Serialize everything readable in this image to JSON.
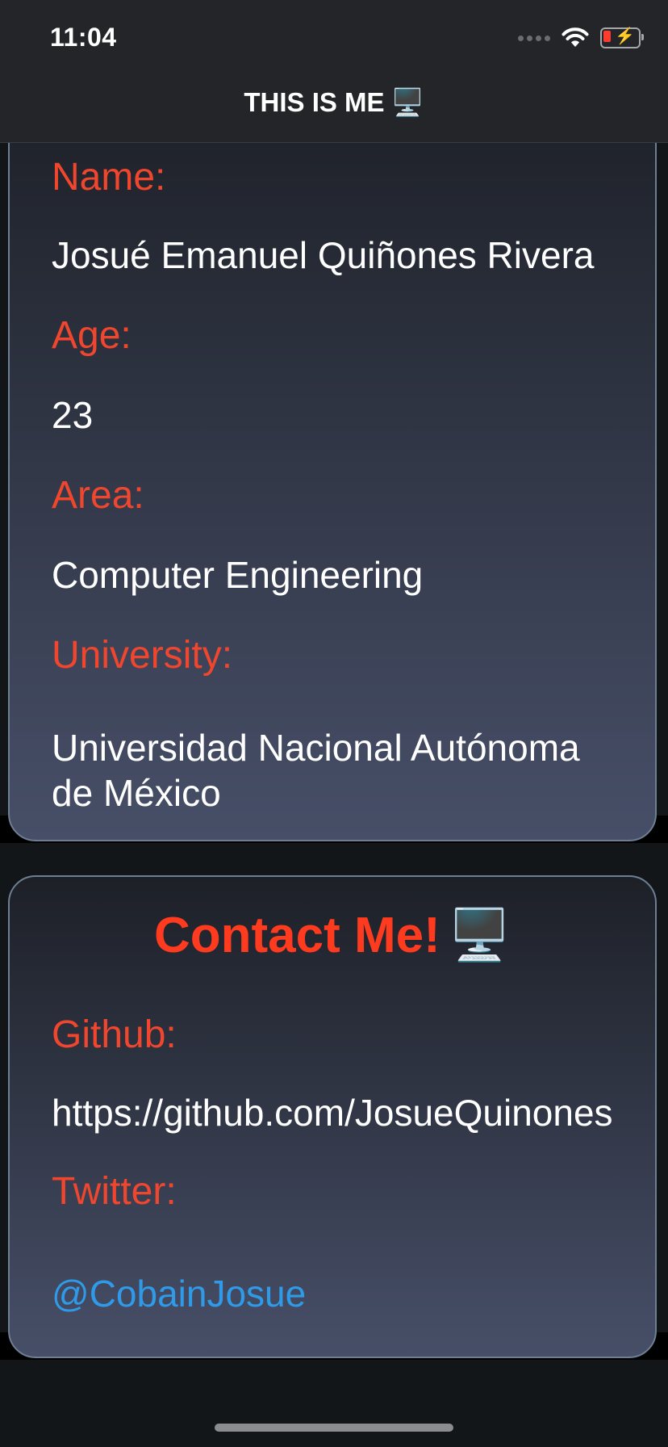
{
  "status_bar": {
    "time": "11:04",
    "icons": [
      "signal-dots-icon",
      "wifi-icon",
      "battery-charging-icon"
    ],
    "battery_color": "#ff3b30"
  },
  "nav": {
    "title": "THIS IS ME",
    "title_emoji": "🖥️"
  },
  "about": {
    "name_label": "Name:",
    "name_value": "Josué Emanuel Quiñones Rivera",
    "age_label": "Age:",
    "age_value": "23",
    "area_label": "Area:",
    "area_value": "Computer Engineering",
    "university_label": "University:",
    "university_value": "Universidad Nacional Autónoma de México"
  },
  "contact": {
    "title": "Contact Me!",
    "title_emoji": "🖥️",
    "github_label": "Github:",
    "github_value": "https://github.com/JosueQuinones",
    "twitter_label": "Twitter:",
    "twitter_value": "@CobainJosue"
  },
  "colors": {
    "label": "#f0462e",
    "title_accent": "#ff3b1f",
    "link": "#2f9be8",
    "card_border": "#6e7f93"
  }
}
